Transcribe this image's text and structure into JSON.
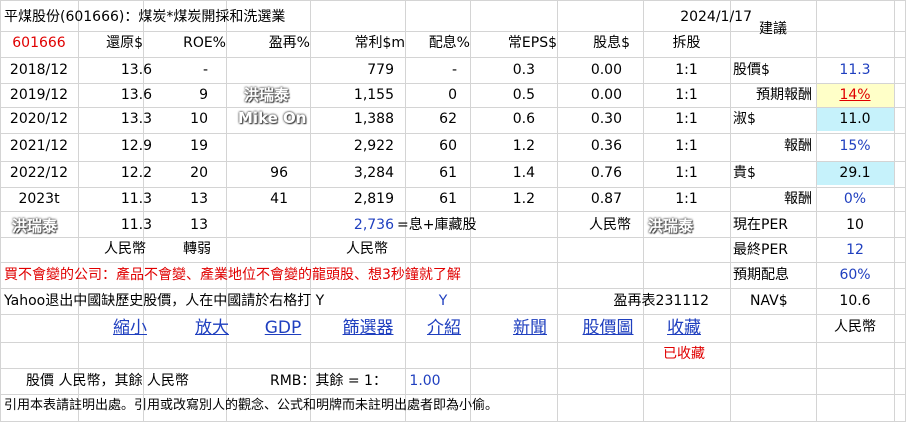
{
  "header": {
    "title": "平煤股份(601666)：煤炭*煤炭開採和洗選業",
    "date": "2024/1/17",
    "suggest_label": "建議"
  },
  "columns": [
    "601666",
    "還原$",
    "ROE%",
    "盈再%",
    "常利$m",
    "配息%",
    "常EPS$",
    "股息$",
    "拆股"
  ],
  "rows": [
    {
      "year": "2018/12",
      "restore": "13.6",
      "roe": "-",
      "reinvest": "",
      "profit": "779",
      "payout": "-",
      "eps": "0.3",
      "div": "0.00",
      "split": "1:1"
    },
    {
      "year": "2019/12",
      "restore": "13.6",
      "roe": "9",
      "reinvest": "",
      "profit": "1,155",
      "payout": "0",
      "eps": "0.5",
      "div": "0.00",
      "split": "1:1"
    },
    {
      "year": "2020/12",
      "restore": "13.3",
      "roe": "10",
      "reinvest": "",
      "profit": "1,388",
      "payout": "62",
      "eps": "0.6",
      "div": "0.30",
      "split": "1:1"
    },
    {
      "year": "2021/12",
      "restore": "12.9",
      "roe": "19",
      "reinvest": "",
      "profit": "2,922",
      "payout": "60",
      "eps": "1.2",
      "div": "0.36",
      "split": "1:1"
    },
    {
      "year": "2022/12",
      "restore": "12.2",
      "roe": "20",
      "reinvest": "96",
      "profit": "3,284",
      "payout": "61",
      "eps": "1.4",
      "div": "0.76",
      "split": "1:1"
    },
    {
      "year": "2023t",
      "restore": "11.3",
      "roe": "13",
      "reinvest": "41",
      "profit": "2,819",
      "payout": "61",
      "eps": "1.2",
      "div": "0.87",
      "split": "1:1"
    }
  ],
  "extra": {
    "restore": "11.3",
    "roe": "13",
    "profit": "2,736",
    "profit_note": "=息+庫藏股",
    "currency": "人民幣"
  },
  "unit_row": {
    "restore": "人民幣",
    "roe": "轉弱",
    "profit": "人民幣"
  },
  "side": {
    "price_label": "股價$",
    "price": "11.3",
    "exp_return_label": "預期報酬",
    "exp_return": "14%",
    "cheap_label": "淑$",
    "cheap": "11.0",
    "cheap_return_label": "報酬",
    "cheap_return": "15%",
    "expensive_label": "貴$",
    "expensive": "29.1",
    "exp_ret2_label": "報酬",
    "exp_ret2": "0%",
    "per_now_label": "現在PER",
    "per_now": "10",
    "per_final_label": "最終PER",
    "per_final": "12",
    "exp_div_label": "預期配息",
    "exp_div": "60%",
    "nav_label": "NAV$",
    "nav": "10.6",
    "currency": "人民幣"
  },
  "notice": "買不會變的公司：產品不會變、產業地位不會變的龍頭股、想3秒鐘就了解",
  "yahoo": {
    "text": "Yahoo退出中國缺歷史股價，人在中國請於右格打 Y",
    "value": "Y",
    "table_id": "盈再表231112"
  },
  "links": [
    "縮小",
    "放大",
    "GDP",
    "篩選器",
    "介紹",
    "新聞",
    "股價圖",
    "收藏"
  ],
  "saved": "已收藏",
  "currency_line": {
    "text": "股價 人民幣，其餘 人民幣",
    "rmb_label": "RMB：其餘 = 1：",
    "rmb_value": "1.00"
  },
  "footer": "引用本表請註明出處。引用或改寫別人的觀念、公式和明牌而未註明出處者即為小偷。",
  "watermarks": [
    "洪瑞泰",
    "Mike On",
    "洪瑞泰",
    "洪瑞泰"
  ],
  "colors": {
    "red": "#e00000",
    "blue": "#1f3fbf",
    "highlight_yellow": "#ffffc8",
    "highlight_cyan": "#c6f2fb",
    "grid": "#d4d4d4"
  }
}
